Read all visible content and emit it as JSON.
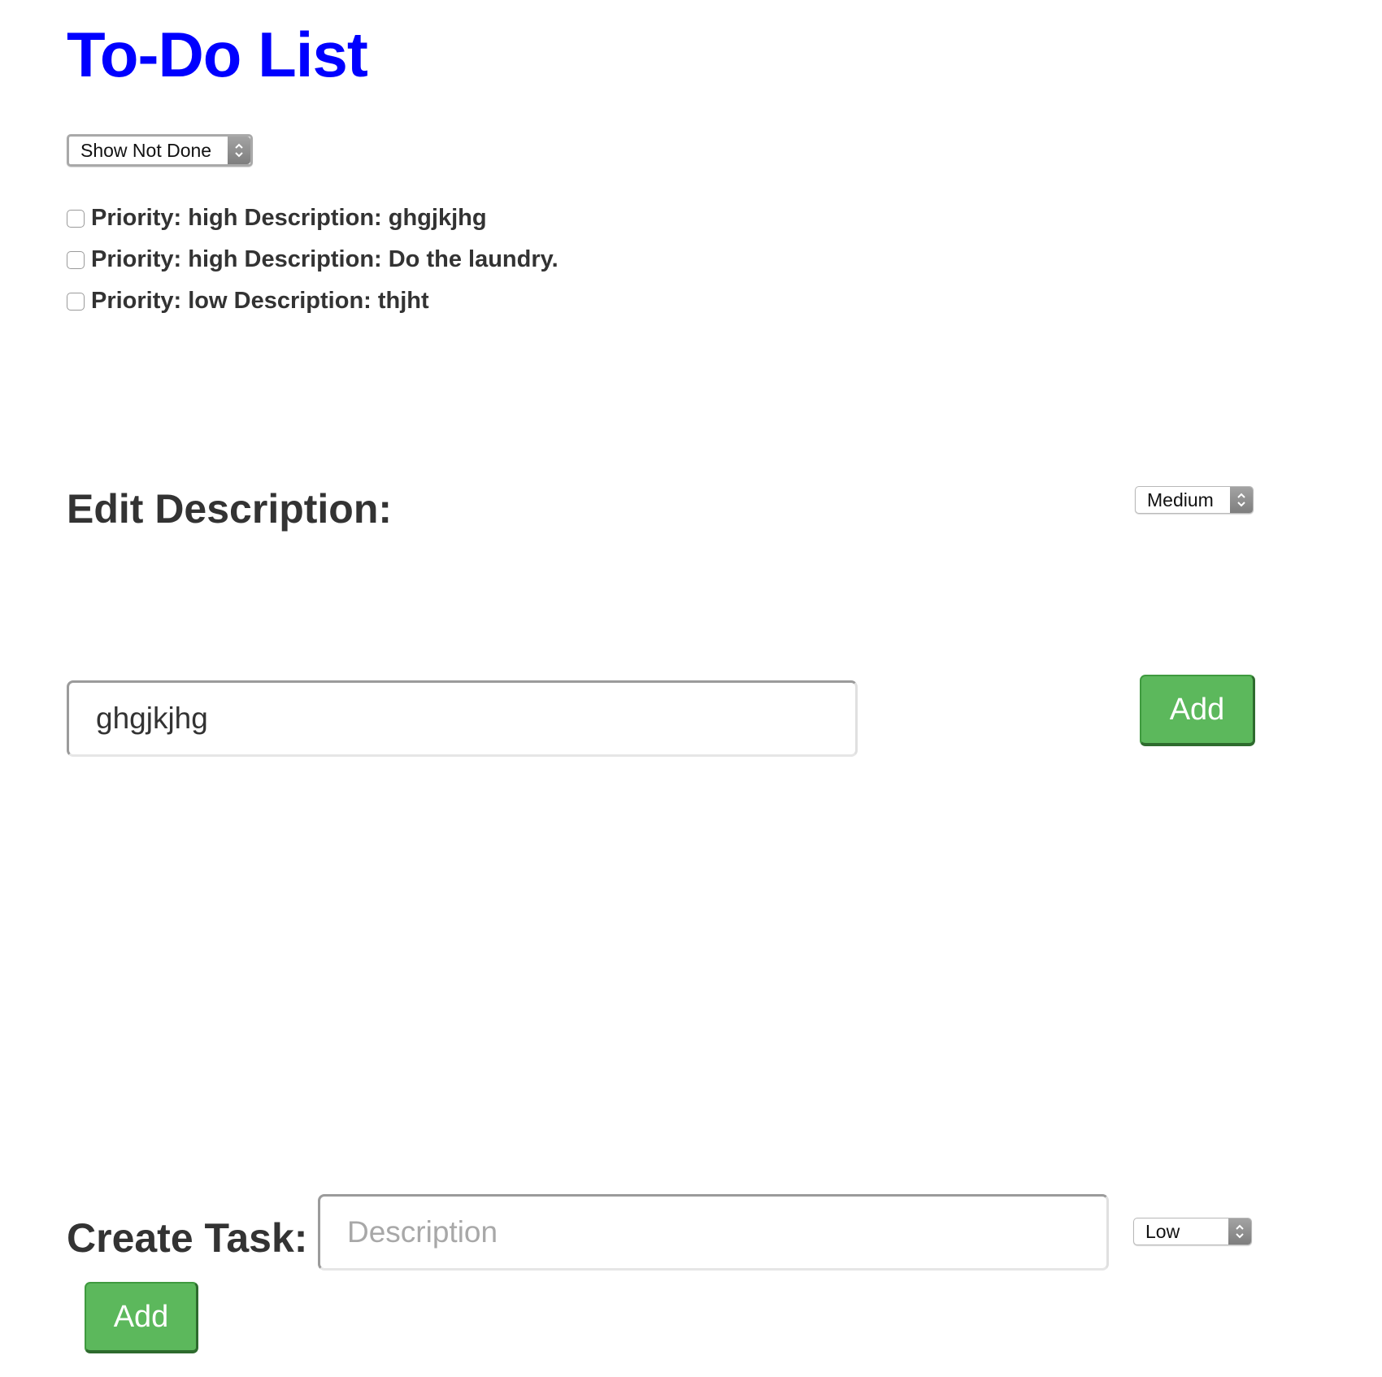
{
  "app": {
    "title": "To-Do List",
    "title_color": "#0000ff"
  },
  "filter": {
    "selected": "Show Not Done"
  },
  "tasks": [
    {
      "text": "Priority: high Description: ghgjkjhg",
      "done": false
    },
    {
      "text": "Priority: high Description: Do the laundry.",
      "done": false
    },
    {
      "text": "Priority: low Description: thjht",
      "done": false
    }
  ],
  "edit": {
    "heading": "Edit Description:",
    "priority_selected": "Medium",
    "description_value": "ghgjkjhg",
    "add_label": "Add"
  },
  "create": {
    "heading": "Create Task:",
    "description_placeholder": "Description",
    "priority_selected": "Low",
    "add_label": "Add"
  },
  "colors": {
    "button_green": "#5cb85c",
    "text_dark": "#333333"
  },
  "icons": {
    "select_arrows": "up-down-chevron-icon"
  }
}
